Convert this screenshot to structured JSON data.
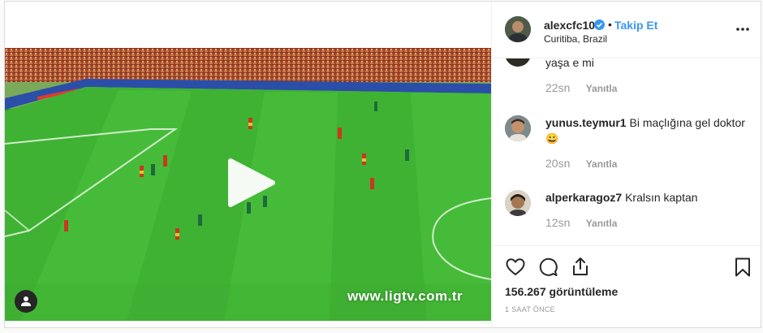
{
  "post": {
    "author": {
      "username": "alexcfc10",
      "verified": true,
      "follow_label": "Takip Et",
      "location": "Curitiba, Brazil"
    },
    "video": {
      "watermark": "www.ligtv.com.tr",
      "playing": false
    },
    "comments": [
      {
        "username": "",
        "text": "yaşa e mi",
        "time": "22sn",
        "reply_label": "Yanıtla"
      },
      {
        "username": "yunus.teymur1",
        "text": "Bi maçlığına gel doktor",
        "emoji": "😀",
        "time": "20sn",
        "reply_label": "Yanıtla"
      },
      {
        "username": "alperkaragoz7",
        "text": "Kralsın kaptan",
        "time": "12sn",
        "reply_label": "Yanıtla"
      }
    ],
    "views_label": "156.267 görüntüleme",
    "time_ago": "1 SAAT ÖNCE"
  },
  "colors": {
    "link_blue": "#3897f0",
    "text": "#262626",
    "muted": "#999999",
    "border": "#dbdbdb"
  }
}
